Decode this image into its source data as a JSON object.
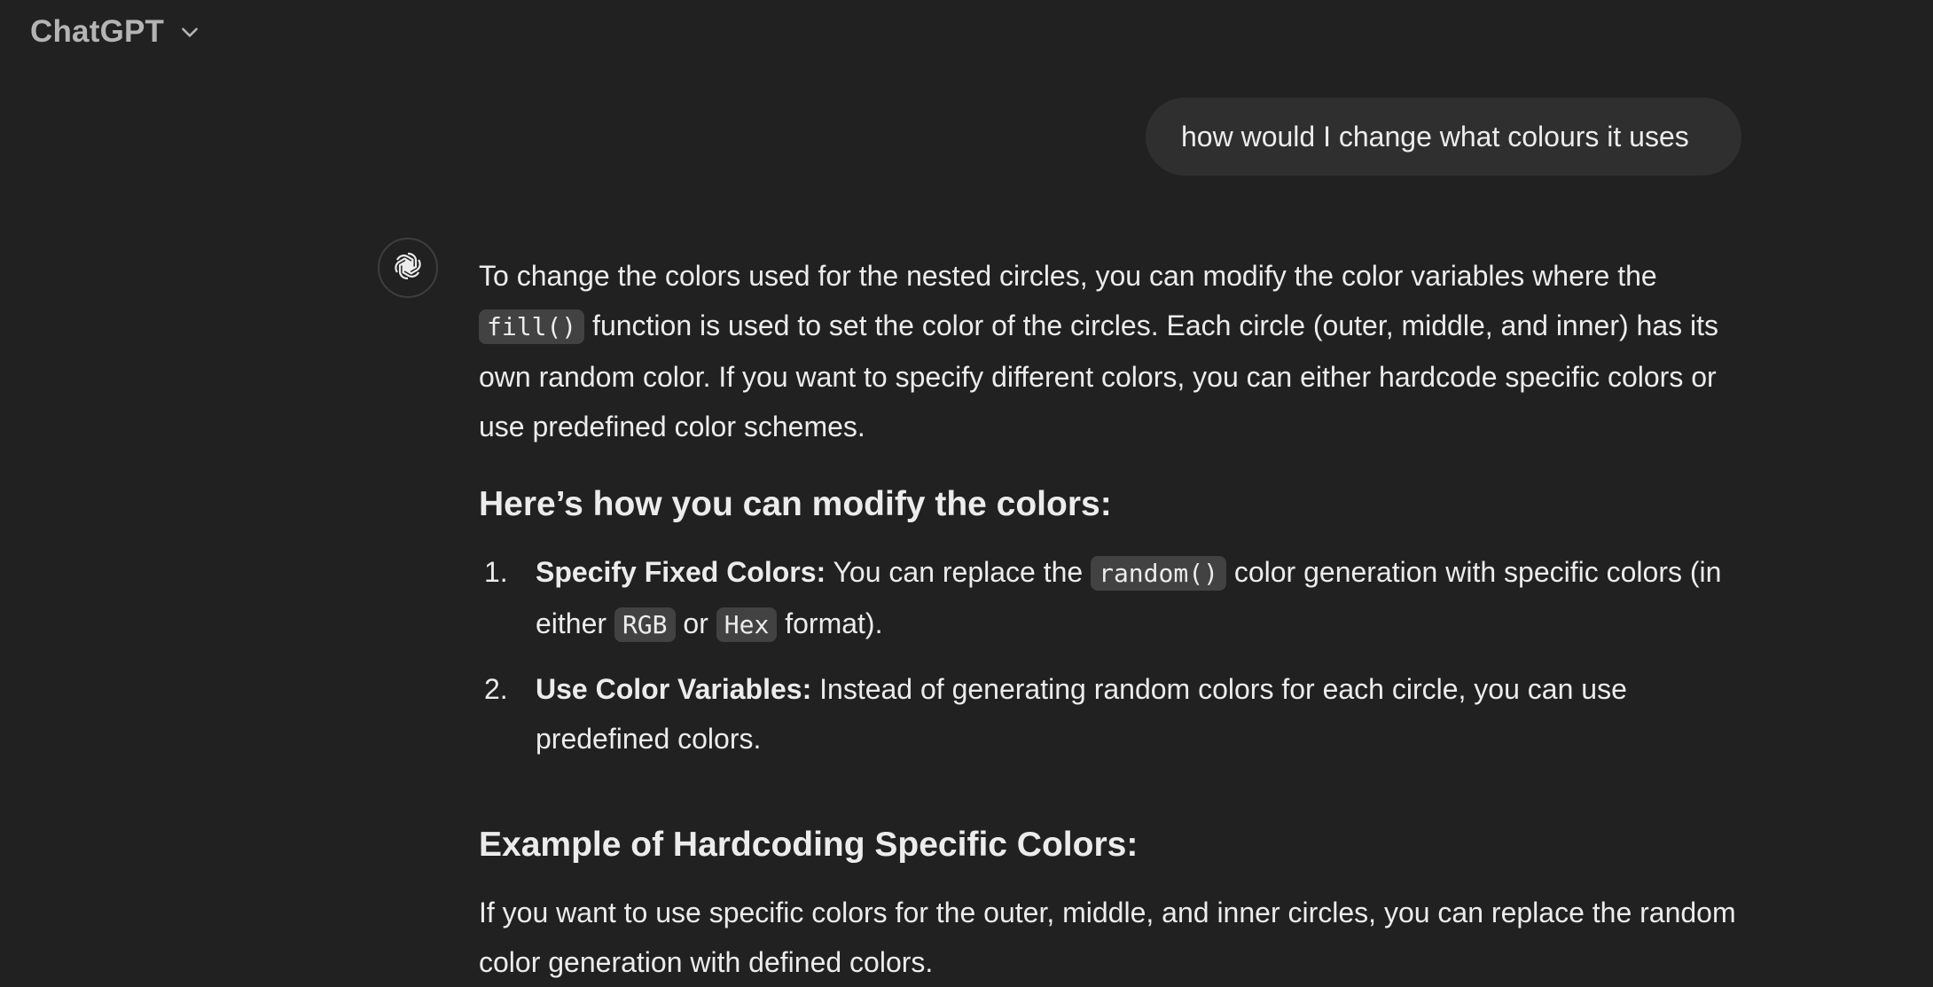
{
  "header": {
    "model_name": "ChatGPT",
    "dropdown_icon": "chevron-down-icon"
  },
  "user_message": {
    "text": "how would I change what colours it uses"
  },
  "assistant": {
    "avatar_icon": "openai-logo-icon",
    "para1": {
      "text_a": "To change the colors used for the nested circles, you can modify the color variables where the ",
      "code_a": "fill()",
      "text_b": " function is used to set the color of the circles. Each circle (outer, middle, and inner) has its own random color. If you want to specify different colors, you can either hardcode specific colors or use predefined color schemes."
    },
    "heading1": "Here’s how you can modify the colors:",
    "steps": [
      {
        "number": "1.",
        "title": "Specify Fixed Colors:",
        "text_a": " You can replace the ",
        "code_a": "random()",
        "text_b": " color generation with specific colors (in either ",
        "code_b": "RGB",
        "text_c": " or ",
        "code_c": "Hex",
        "text_d": " format)."
      },
      {
        "number": "2.",
        "title": "Use Color Variables:",
        "text": " Instead of generating random colors for each circle, you can use predefined colors."
      }
    ],
    "heading2": "Example of Hardcoding Specific Colors:",
    "para2": "If you want to use specific colors for the outer, middle, and inner circles, you can replace the random color generation with defined colors."
  },
  "colors": {
    "background": "#212121",
    "bubble": "#2f2f2f",
    "text": "#ececec",
    "muted": "#b4b4b4",
    "code_bg": "#424242"
  }
}
